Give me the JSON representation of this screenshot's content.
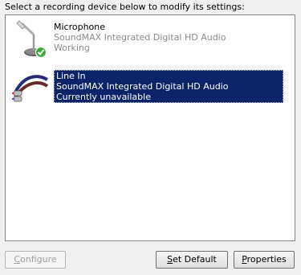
{
  "instruction": "Select a recording device below to modify its settings:",
  "devices": [
    {
      "name": "Microphone",
      "driver": "SoundMAX Integrated Digital HD Audio",
      "status": "Working",
      "icon": "microphone-icon",
      "default": true,
      "selected": false
    },
    {
      "name": "Line In",
      "driver": "SoundMAX Integrated Digital HD Audio",
      "status": "Currently unavailable",
      "icon": "line-in-cable-icon",
      "default": false,
      "selected": true
    }
  ],
  "buttons": {
    "configure": {
      "label": "Configure",
      "accel": "C",
      "rest": "onfigure",
      "enabled": false
    },
    "set_default": {
      "label": "Set Default",
      "accel": "S",
      "rest": "et Default",
      "enabled": true
    },
    "properties": {
      "label": "Properties",
      "accel": "P",
      "rest": "roperties",
      "enabled": true
    }
  },
  "colors": {
    "selection": "#0a246a",
    "check_badge": "#3aa83a"
  }
}
